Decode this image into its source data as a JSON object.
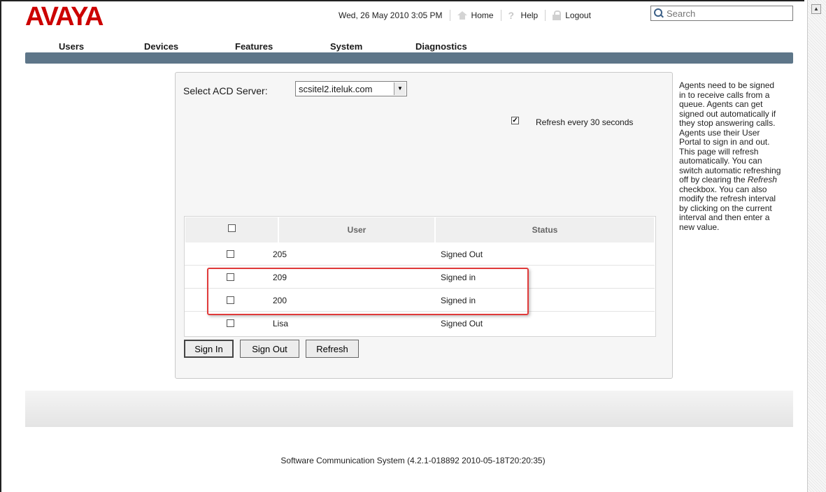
{
  "brand": {
    "logo_text": "AVAYA",
    "logo_color": "#cc0000"
  },
  "topbar": {
    "datetime": "Wed, 26 May 2010 3:05 PM",
    "home_label": "Home",
    "help_label": "Help",
    "logout_label": "Logout",
    "search_placeholder": "Search"
  },
  "nav": {
    "items": [
      "Users",
      "Devices",
      "Features",
      "System",
      "Diagnostics"
    ]
  },
  "form": {
    "acd_label": "Select ACD Server:",
    "acd_value": "scsitel2.iteluk.com",
    "refresh_checked": true,
    "refresh_label": "Refresh every  30  seconds"
  },
  "table": {
    "columns": [
      "User",
      "Status"
    ],
    "rows": [
      {
        "user": "205",
        "status": "Signed Out"
      },
      {
        "user": "209",
        "status": "Signed in"
      },
      {
        "user": "200",
        "status": "Signed in"
      },
      {
        "user": "Lisa",
        "status": "Signed Out"
      }
    ]
  },
  "buttons": {
    "sign_in": "Sign In",
    "sign_out": "Sign Out",
    "refresh": "Refresh"
  },
  "help": {
    "part1": "Agents need to be signed in to receive calls from a queue. Agents can get signed out automatically if they stop answering calls. Agents use their User Portal to sign in and out. This page will refresh automatically. You can switch automatic refreshing off by clearing the ",
    "emphasis": "Refresh",
    "part2": " checkbox. You can also modify the refresh interval by clicking on the current interval and then enter a new value."
  },
  "footer": {
    "version_text": "Software Communication System (4.2.1-018892 2010-05-18T20:20:35)"
  },
  "colors": {
    "nav_strip": "#5e7689",
    "highlight": "#e03a3a"
  }
}
